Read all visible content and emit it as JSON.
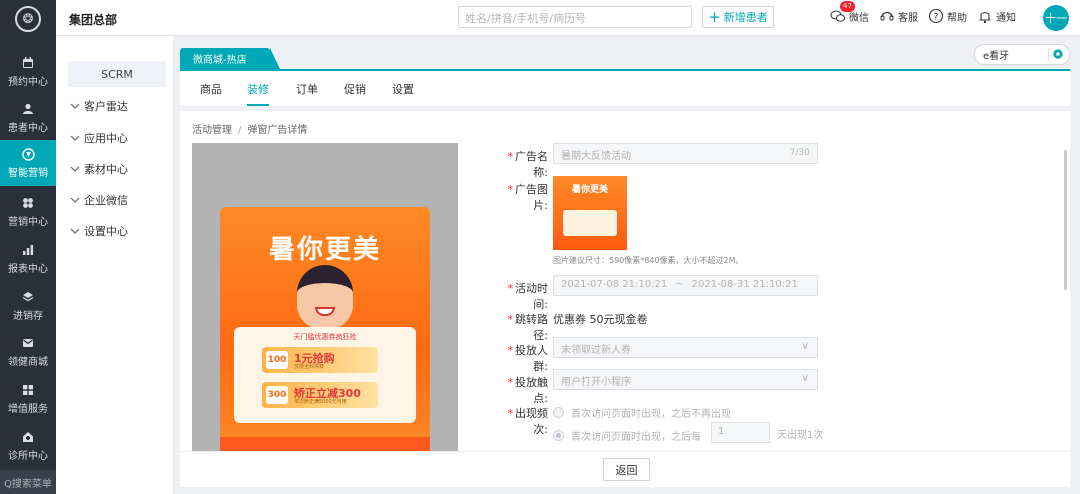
{
  "nav": {
    "items": [
      {
        "label": "预约中心",
        "icon": "calendar-icon"
      },
      {
        "label": "患者中心",
        "icon": "user-icon"
      },
      {
        "label": "智能营销",
        "icon": "marketing-icon"
      },
      {
        "label": "营销中心",
        "icon": "grid-icon"
      },
      {
        "label": "报表中心",
        "icon": "bar-chart-icon"
      },
      {
        "label": "进销存",
        "icon": "layers-icon"
      },
      {
        "label": "领健商城",
        "icon": "mail-icon"
      },
      {
        "label": "增值服务",
        "icon": "apps-icon"
      },
      {
        "label": "诊所中心",
        "icon": "home-icon"
      }
    ],
    "search_label": "Q搜索菜单",
    "active_color": "#00a7b5"
  },
  "header": {
    "org": "集团总部",
    "search_placeholder": "姓名/拼音/手机号/病历号",
    "new_patient": "新增患者",
    "wechat": "微信",
    "wechat_badge": "47",
    "service": "客服",
    "help": "帮助",
    "notify": "通知",
    "avatar": "十一"
  },
  "subnav": {
    "scrm": "SCRM",
    "groups": [
      "客户雷达",
      "应用中心",
      "素材中心",
      "企业微信",
      "设置中心"
    ]
  },
  "store_tab": "微商城-热店",
  "store_select": "e看牙",
  "tabs": [
    "商品",
    "装修",
    "订单",
    "促销",
    "设置"
  ],
  "breadcrumb": [
    "活动管理",
    "弹窗广告详情"
  ],
  "poster": {
    "title": "暑你更美",
    "card_title": "天门槛优惠券疯狂抢",
    "coupons": [
      {
        "amount": "100",
        "text": "1元抢购",
        "sub": "仅限全科项目"
      },
      {
        "amount": "300",
        "text": "矫正立减300",
        "sub": "单次矫正满5000元可用"
      }
    ]
  },
  "form": {
    "name_label": "广告名称:",
    "name_value": "暑期大反馈活动",
    "name_count": "7/30",
    "image_label": "广告图片:",
    "image_thumb_title": "暑你更美",
    "image_hint": "图片建议尺寸：590像素*840像素，大小不超过2M。",
    "time_label": "活动时间:",
    "time_start": "2021-07-08 21:10:21",
    "time_sep": "~",
    "time_end": "2021-08-31 21:10:21",
    "jump_label": "跳转路径:",
    "jump_value": "优惠券 50元现金卷",
    "crowd_label": "投放人群:",
    "crowd_value": "未领取过新人券",
    "trigger_label": "投放触点:",
    "trigger_value": "用户打开小程序",
    "freq_label": "出现频次:",
    "freq_option1": "首次访问页面时出现，之后不再出现",
    "freq_option2": "首次访问页面时出现，之后每",
    "freq_days": "1",
    "freq_suffix": "天出现1次"
  },
  "footer": {
    "back": "返回"
  }
}
